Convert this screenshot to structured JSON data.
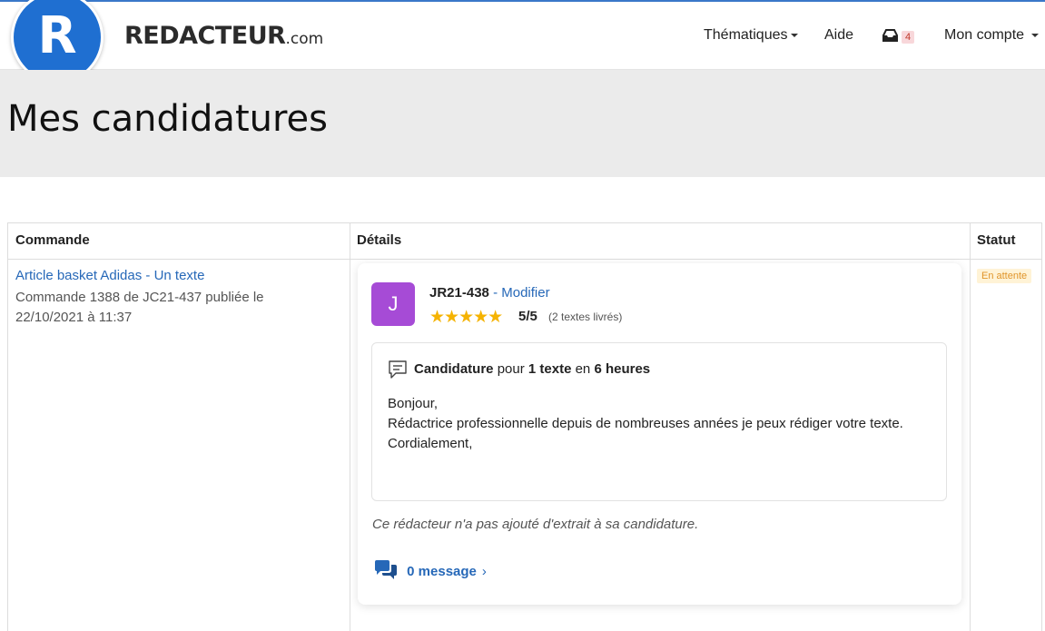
{
  "brand": {
    "logo_letter": "R",
    "name": "REDACTEUR",
    "suffix": ".com"
  },
  "nav": {
    "thematiques": "Thématiques",
    "aide": "Aide",
    "inbox_icon": "inbox-icon",
    "inbox_count": "4",
    "compte": "Mon compte"
  },
  "page_title": "Mes candidatures",
  "table": {
    "headers": {
      "commande": "Commande",
      "details": "Détails",
      "statut": "Statut"
    },
    "row": {
      "order_link": "Article basket Adidas - Un texte",
      "order_info": "Commande 1388 de JC21-437 publiée le 22/10/2021 à 11:37",
      "status": "En attente",
      "details": {
        "avatar_letter": "J",
        "writer_id": "JR21-438",
        "separator": "-",
        "modify": "Modifier",
        "stars": "★★★★★",
        "score": "5/5",
        "texts_delivered": "(2 textes livrés)",
        "candidature": {
          "label": "Candidature",
          "pour": "pour",
          "qty": "1 texte",
          "en": "en",
          "duration": "6 heures"
        },
        "message_lines": [
          "Bonjour,",
          "Rédactrice professionnelle depuis de nombreuses années je peux rédiger votre texte.",
          "Cordialement,"
        ],
        "no_extract": "Ce rédacteur n'a pas ajouté d'extrait à sa candidature.",
        "messages": "0 message",
        "chevron": "›"
      }
    }
  },
  "colors": {
    "accent": "#2668b8",
    "brand_blue": "#1f6fd1",
    "avatar": "#a64bd6",
    "stars": "#f5b301",
    "status": "#e0952a"
  }
}
